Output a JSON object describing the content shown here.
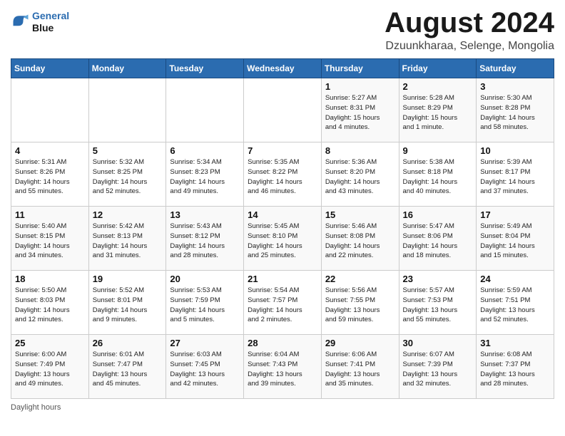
{
  "header": {
    "logo_line1": "General",
    "logo_line2": "Blue",
    "month_title": "August 2024",
    "location": "Dzuunkharaa, Selenge, Mongolia"
  },
  "days_of_week": [
    "Sunday",
    "Monday",
    "Tuesday",
    "Wednesday",
    "Thursday",
    "Friday",
    "Saturday"
  ],
  "footer_text": "Daylight hours",
  "weeks": [
    [
      {
        "day": "",
        "info": ""
      },
      {
        "day": "",
        "info": ""
      },
      {
        "day": "",
        "info": ""
      },
      {
        "day": "",
        "info": ""
      },
      {
        "day": "1",
        "info": "Sunrise: 5:27 AM\nSunset: 8:31 PM\nDaylight: 15 hours\nand 4 minutes."
      },
      {
        "day": "2",
        "info": "Sunrise: 5:28 AM\nSunset: 8:29 PM\nDaylight: 15 hours\nand 1 minute."
      },
      {
        "day": "3",
        "info": "Sunrise: 5:30 AM\nSunset: 8:28 PM\nDaylight: 14 hours\nand 58 minutes."
      }
    ],
    [
      {
        "day": "4",
        "info": "Sunrise: 5:31 AM\nSunset: 8:26 PM\nDaylight: 14 hours\nand 55 minutes."
      },
      {
        "day": "5",
        "info": "Sunrise: 5:32 AM\nSunset: 8:25 PM\nDaylight: 14 hours\nand 52 minutes."
      },
      {
        "day": "6",
        "info": "Sunrise: 5:34 AM\nSunset: 8:23 PM\nDaylight: 14 hours\nand 49 minutes."
      },
      {
        "day": "7",
        "info": "Sunrise: 5:35 AM\nSunset: 8:22 PM\nDaylight: 14 hours\nand 46 minutes."
      },
      {
        "day": "8",
        "info": "Sunrise: 5:36 AM\nSunset: 8:20 PM\nDaylight: 14 hours\nand 43 minutes."
      },
      {
        "day": "9",
        "info": "Sunrise: 5:38 AM\nSunset: 8:18 PM\nDaylight: 14 hours\nand 40 minutes."
      },
      {
        "day": "10",
        "info": "Sunrise: 5:39 AM\nSunset: 8:17 PM\nDaylight: 14 hours\nand 37 minutes."
      }
    ],
    [
      {
        "day": "11",
        "info": "Sunrise: 5:40 AM\nSunset: 8:15 PM\nDaylight: 14 hours\nand 34 minutes."
      },
      {
        "day": "12",
        "info": "Sunrise: 5:42 AM\nSunset: 8:13 PM\nDaylight: 14 hours\nand 31 minutes."
      },
      {
        "day": "13",
        "info": "Sunrise: 5:43 AM\nSunset: 8:12 PM\nDaylight: 14 hours\nand 28 minutes."
      },
      {
        "day": "14",
        "info": "Sunrise: 5:45 AM\nSunset: 8:10 PM\nDaylight: 14 hours\nand 25 minutes."
      },
      {
        "day": "15",
        "info": "Sunrise: 5:46 AM\nSunset: 8:08 PM\nDaylight: 14 hours\nand 22 minutes."
      },
      {
        "day": "16",
        "info": "Sunrise: 5:47 AM\nSunset: 8:06 PM\nDaylight: 14 hours\nand 18 minutes."
      },
      {
        "day": "17",
        "info": "Sunrise: 5:49 AM\nSunset: 8:04 PM\nDaylight: 14 hours\nand 15 minutes."
      }
    ],
    [
      {
        "day": "18",
        "info": "Sunrise: 5:50 AM\nSunset: 8:03 PM\nDaylight: 14 hours\nand 12 minutes."
      },
      {
        "day": "19",
        "info": "Sunrise: 5:52 AM\nSunset: 8:01 PM\nDaylight: 14 hours\nand 9 minutes."
      },
      {
        "day": "20",
        "info": "Sunrise: 5:53 AM\nSunset: 7:59 PM\nDaylight: 14 hours\nand 5 minutes."
      },
      {
        "day": "21",
        "info": "Sunrise: 5:54 AM\nSunset: 7:57 PM\nDaylight: 14 hours\nand 2 minutes."
      },
      {
        "day": "22",
        "info": "Sunrise: 5:56 AM\nSunset: 7:55 PM\nDaylight: 13 hours\nand 59 minutes."
      },
      {
        "day": "23",
        "info": "Sunrise: 5:57 AM\nSunset: 7:53 PM\nDaylight: 13 hours\nand 55 minutes."
      },
      {
        "day": "24",
        "info": "Sunrise: 5:59 AM\nSunset: 7:51 PM\nDaylight: 13 hours\nand 52 minutes."
      }
    ],
    [
      {
        "day": "25",
        "info": "Sunrise: 6:00 AM\nSunset: 7:49 PM\nDaylight: 13 hours\nand 49 minutes."
      },
      {
        "day": "26",
        "info": "Sunrise: 6:01 AM\nSunset: 7:47 PM\nDaylight: 13 hours\nand 45 minutes."
      },
      {
        "day": "27",
        "info": "Sunrise: 6:03 AM\nSunset: 7:45 PM\nDaylight: 13 hours\nand 42 minutes."
      },
      {
        "day": "28",
        "info": "Sunrise: 6:04 AM\nSunset: 7:43 PM\nDaylight: 13 hours\nand 39 minutes."
      },
      {
        "day": "29",
        "info": "Sunrise: 6:06 AM\nSunset: 7:41 PM\nDaylight: 13 hours\nand 35 minutes."
      },
      {
        "day": "30",
        "info": "Sunrise: 6:07 AM\nSunset: 7:39 PM\nDaylight: 13 hours\nand 32 minutes."
      },
      {
        "day": "31",
        "info": "Sunrise: 6:08 AM\nSunset: 7:37 PM\nDaylight: 13 hours\nand 28 minutes."
      }
    ]
  ]
}
